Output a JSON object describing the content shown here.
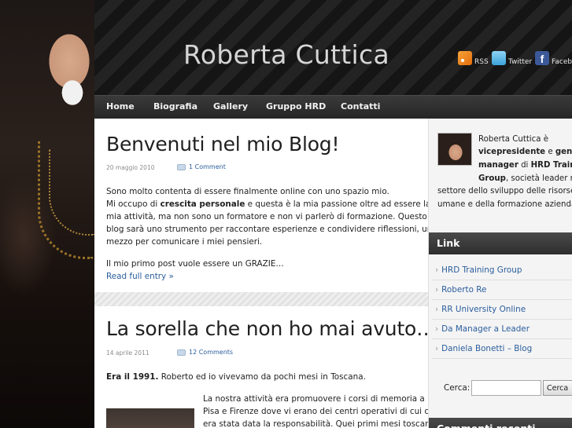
{
  "header": {
    "site_title": "Roberta Cuttica",
    "social": [
      {
        "label": "RSS",
        "icon": "rss-icon"
      },
      {
        "label": "Twitter",
        "icon": "twitter-icon"
      },
      {
        "label": "Facebook",
        "icon": "facebook-icon"
      }
    ]
  },
  "nav": {
    "items": [
      "Home",
      "Biografia",
      "Gallery",
      "Gruppo HRD",
      "Contatti"
    ]
  },
  "posts": [
    {
      "title": "Benvenuti nel mio Blog!",
      "date": "20 maggio 2010",
      "comments": "1 Comment",
      "lines": [
        "Sono molto contenta di essere finalmente online con uno spazio mio.",
        "Mi occupo di ",
        "crescita personale",
        " e questa è la mia passione oltre ad essere la",
        "mia attività, ma non sono un formatore e non vi parlerò di formazione. Questo",
        "blog sarà uno strumento per raccontare esperienze e condividere riflessioni, un",
        "mezzo per comunicare i miei pensieri.",
        "Il mio primo post vuole essere un GRAZIE…"
      ],
      "read_more": "Read full entry »"
    },
    {
      "title": "La sorella che non ho mai avuto…",
      "date": "14 aprile 2011",
      "comments": "12 Comments",
      "lead_bold": "Era il 1991.",
      "lead_rest": " Roberto ed io vivevamo da pochi mesi in Toscana.",
      "lines": [
        "La nostra attività era promuovere i corsi di memoria a",
        "Pisa e Firenze dove vi erano dei centri operativi di cui ci",
        "era stata data la responsabilità. Quei primi mesi toscani"
      ]
    }
  ],
  "sidebar": {
    "about": {
      "l1a": "Roberta Cuttica è",
      "l2a": "vicepresidente",
      "l2b": " e ",
      "l2c": "general",
      "l3a": "manager",
      "l3b": " di ",
      "l3c": "HRD Training",
      "l4a": "Group",
      "l4b": ", società leader nel",
      "l5": "settore dello sviluppo delle risorse",
      "l6": "umane e della formazione aziendale."
    },
    "link_heading": "Link",
    "links": [
      "HRD Training Group",
      "Roberto Re",
      "RR University Online",
      "Da Manager a Leader",
      "Daniela Bonetti – Blog"
    ],
    "search_label": "Cerca:",
    "search_value": "",
    "search_button": "Cerca",
    "recent_heading": "Commenti recenti"
  }
}
